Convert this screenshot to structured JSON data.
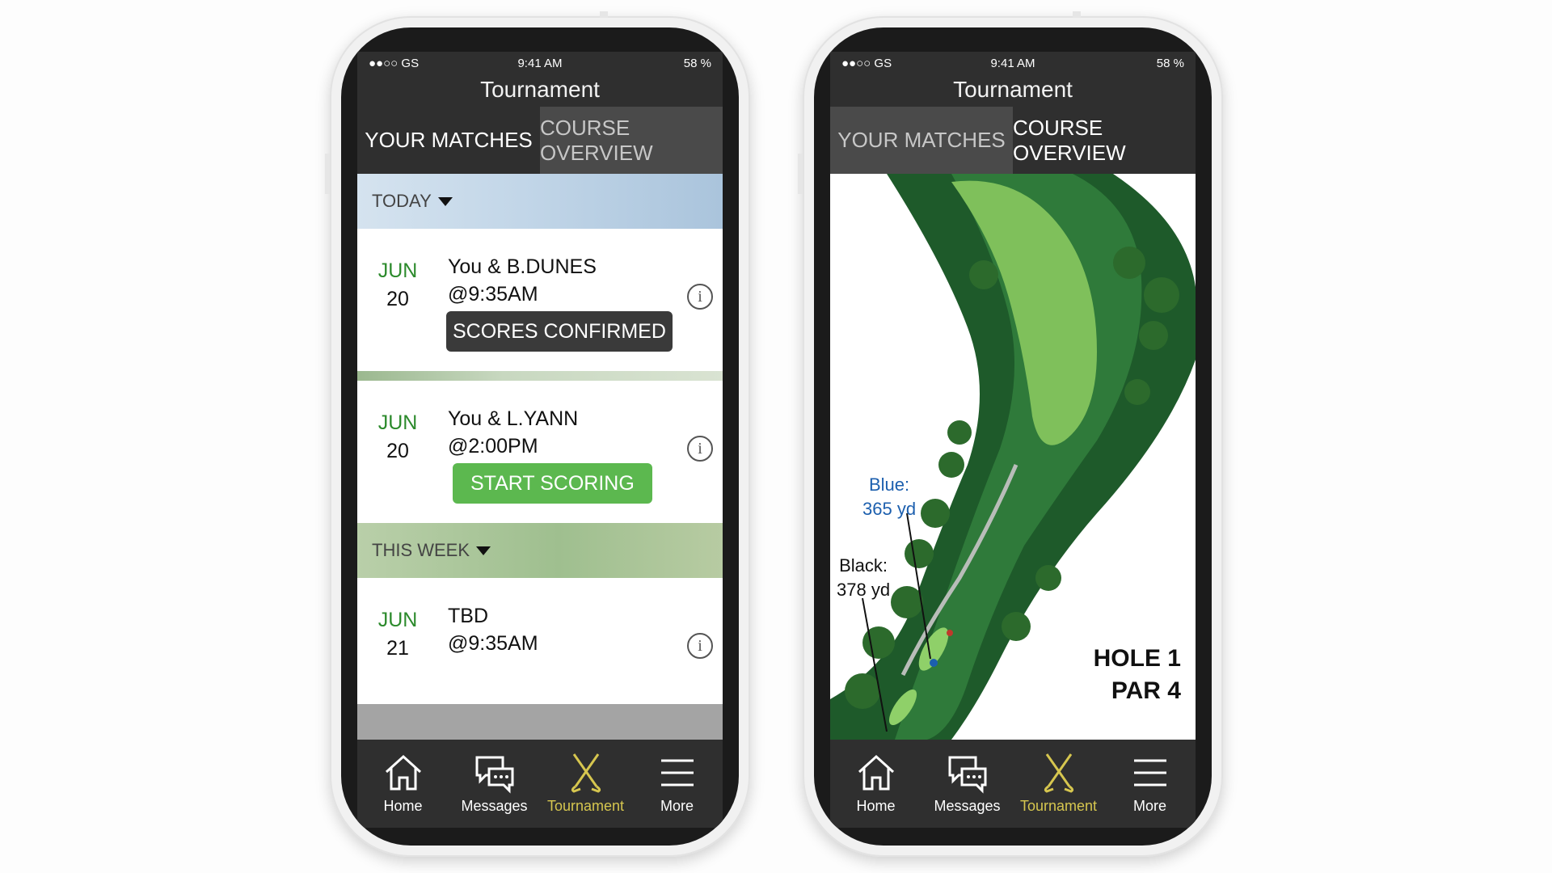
{
  "colors": {
    "accent_green": "#2c8a2c",
    "active_tab": "#d6c64f",
    "button_green": "#5cb84f",
    "header_bg": "#2f2f2f"
  },
  "status_bar": {
    "carrier": "●●○○ GS",
    "time": "9:41 AM",
    "battery": "58 %"
  },
  "screens": [
    {
      "title": "Tournament",
      "tabs": {
        "matches": "YOUR MATCHES",
        "course": "COURSE OVERVIEW",
        "active": "matches"
      },
      "today_label": "TODAY",
      "week_label": "THIS WEEK",
      "matches": [
        {
          "month": "JUN",
          "day": "20",
          "players": "You & B.DUNES",
          "time": "@9:35AM",
          "action": "SCORES CONFIRMED"
        },
        {
          "month": "JUN",
          "day": "20",
          "players": "You & L.YANN",
          "time": "@2:00PM",
          "action": "START SCORING"
        },
        {
          "month": "JUN",
          "day": "21",
          "players": "TBD",
          "time": "@9:35AM"
        }
      ]
    },
    {
      "title": "Tournament",
      "tabs": {
        "matches": "YOUR MATCHES",
        "course": "COURSE OVERVIEW",
        "active": "course"
      },
      "hole_label": "HOLE 1",
      "par_label": "PAR 4",
      "tees": [
        {
          "name": "Blue:",
          "yardage": "365 yd"
        },
        {
          "name": "Black:",
          "yardage": "378 yd"
        }
      ]
    }
  ],
  "tabbar": [
    "Home",
    "Messages",
    "Tournament",
    "More"
  ]
}
